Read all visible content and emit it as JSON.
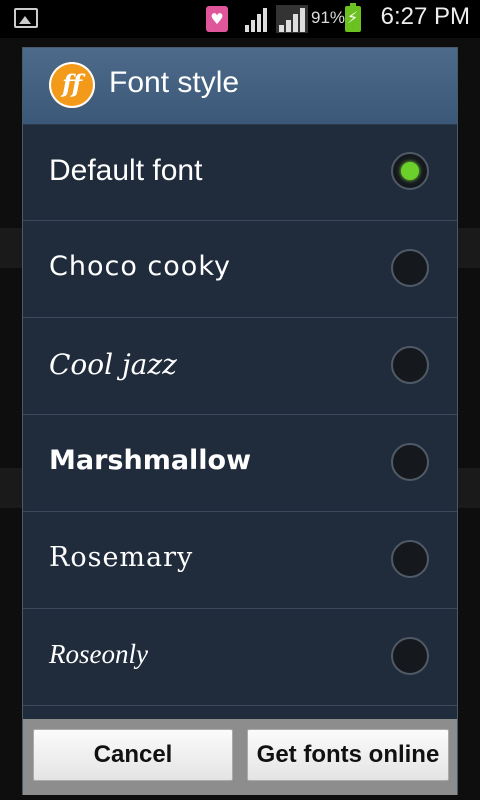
{
  "status_bar": {
    "battery_percent": "91%",
    "time": "6:27 PM"
  },
  "dialog": {
    "title": "Font style",
    "logo_text": "ff",
    "options": [
      {
        "label": "Default font",
        "selected": true
      },
      {
        "label": "Choco cooky",
        "selected": false
      },
      {
        "label": "Cool jazz",
        "selected": false
      },
      {
        "label": "Marshmallow",
        "selected": false
      },
      {
        "label": "Rosemary",
        "selected": false
      },
      {
        "label": "Roseonly",
        "selected": false
      }
    ],
    "buttons": {
      "cancel": "Cancel",
      "get_fonts": "Get fonts online"
    }
  },
  "colors": {
    "header": "#4d6a8a",
    "dialog_bg": "#202c3c",
    "radio_selected": "#6bd12a",
    "logo": "#f39a1b"
  }
}
